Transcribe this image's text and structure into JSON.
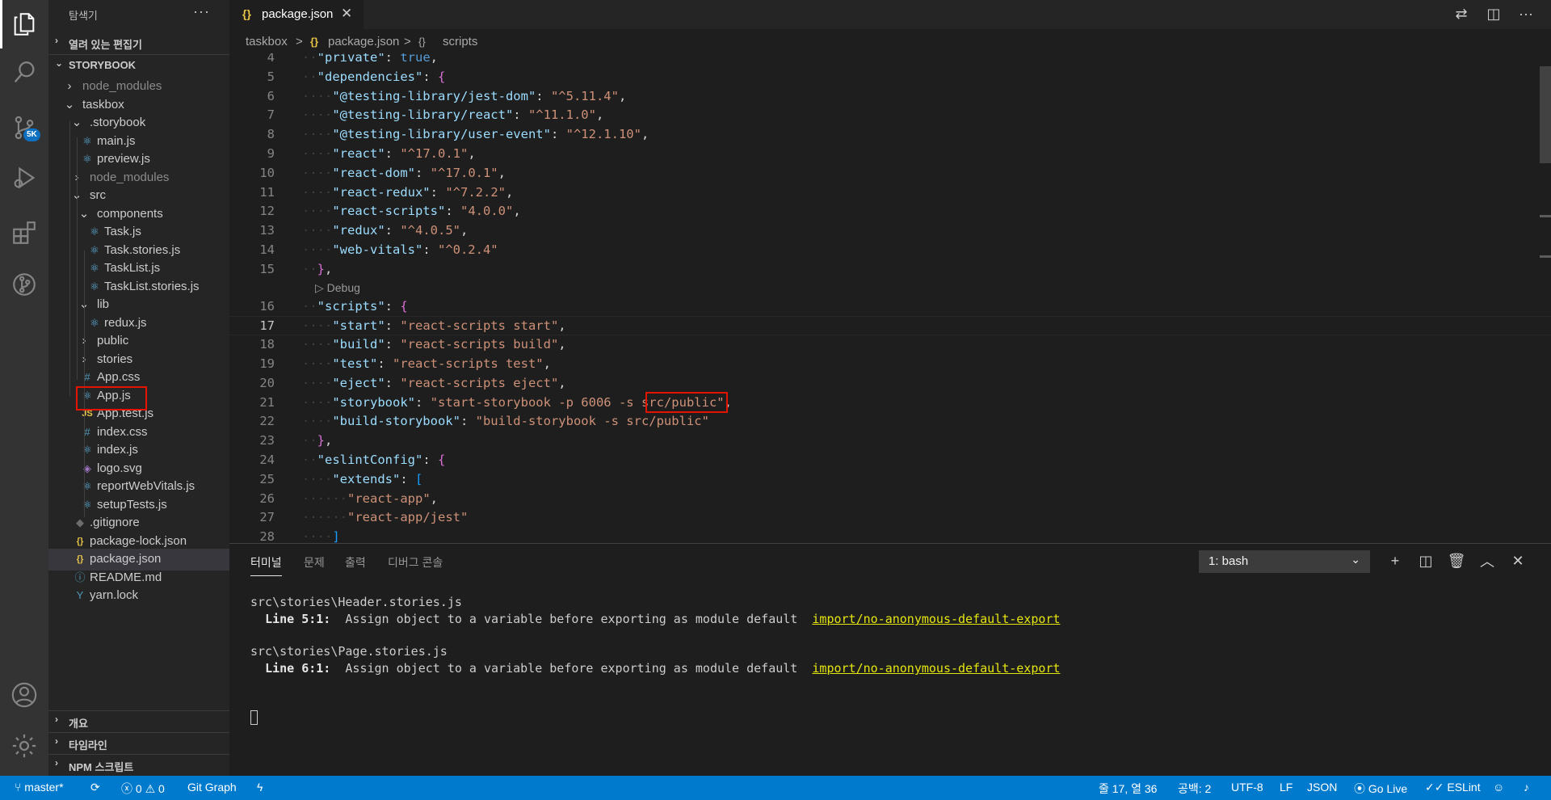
{
  "sidebar": {
    "title": "탐색기",
    "more": "···",
    "open_editors": "열려 있는 편집기",
    "workspace": "STORYBOOK",
    "tree": [
      {
        "name": "node_modules",
        "depth": 0,
        "kind": "folder",
        "open": false,
        "dim": true
      },
      {
        "name": "taskbox",
        "depth": 0,
        "kind": "folder",
        "open": true
      },
      {
        "name": ".storybook",
        "depth": 1,
        "kind": "folder",
        "open": true
      },
      {
        "name": "main.js",
        "depth": 2,
        "kind": "react"
      },
      {
        "name": "preview.js",
        "depth": 2,
        "kind": "react"
      },
      {
        "name": "node_modules",
        "depth": 1,
        "kind": "folder",
        "open": false,
        "dim": true
      },
      {
        "name": "src",
        "depth": 1,
        "kind": "folder",
        "open": true
      },
      {
        "name": "components",
        "depth": 2,
        "kind": "folder",
        "open": true
      },
      {
        "name": "Task.js",
        "depth": 3,
        "kind": "react"
      },
      {
        "name": "Task.stories.js",
        "depth": 3,
        "kind": "react"
      },
      {
        "name": "TaskList.js",
        "depth": 3,
        "kind": "react"
      },
      {
        "name": "TaskList.stories.js",
        "depth": 3,
        "kind": "react"
      },
      {
        "name": "lib",
        "depth": 2,
        "kind": "folder",
        "open": true
      },
      {
        "name": "redux.js",
        "depth": 3,
        "kind": "react"
      },
      {
        "name": "public",
        "depth": 2,
        "kind": "folder",
        "open": false
      },
      {
        "name": "stories",
        "depth": 2,
        "kind": "folder",
        "open": false
      },
      {
        "name": "App.css",
        "depth": 2,
        "kind": "css"
      },
      {
        "name": "App.js",
        "depth": 2,
        "kind": "react"
      },
      {
        "name": "App.test.js",
        "depth": 2,
        "kind": "js"
      },
      {
        "name": "index.css",
        "depth": 2,
        "kind": "css"
      },
      {
        "name": "index.js",
        "depth": 2,
        "kind": "react"
      },
      {
        "name": "logo.svg",
        "depth": 2,
        "kind": "svg"
      },
      {
        "name": "reportWebVitals.js",
        "depth": 2,
        "kind": "react"
      },
      {
        "name": "setupTests.js",
        "depth": 2,
        "kind": "react"
      },
      {
        "name": ".gitignore",
        "depth": 1,
        "kind": "git"
      },
      {
        "name": "package-lock.json",
        "depth": 1,
        "kind": "json"
      },
      {
        "name": "package.json",
        "depth": 1,
        "kind": "json",
        "selected": true
      },
      {
        "name": "README.md",
        "depth": 1,
        "kind": "info"
      },
      {
        "name": "yarn.lock",
        "depth": 1,
        "kind": "yarn"
      }
    ],
    "outline": "개요",
    "timeline": "타임라인",
    "npm_scripts": "NPM 스크립트"
  },
  "activity": {
    "scm_badge": "5K"
  },
  "tab": {
    "icon": "{}",
    "name": "package.json",
    "close": "✕"
  },
  "breadcrumb": {
    "folder": "taskbox",
    "sep": ">",
    "file_icon": "{}",
    "file": "package.json",
    "sym_icon": "{}",
    "symbol": "scripts"
  },
  "code": {
    "codelens": "▷ Debug",
    "lines": [
      {
        "n": "4",
        "indent": 1,
        "toks": [
          [
            "k",
            "\"private\""
          ],
          [
            "p",
            ": "
          ],
          [
            "bool",
            "true"
          ],
          [
            "p",
            ","
          ]
        ]
      },
      {
        "n": "5",
        "indent": 1,
        "toks": [
          [
            "k",
            "\"dependencies\""
          ],
          [
            "p",
            ": "
          ],
          [
            "b2",
            "{"
          ]
        ]
      },
      {
        "n": "6",
        "indent": 2,
        "toks": [
          [
            "k",
            "\"@testing-library/jest-dom\""
          ],
          [
            "p",
            ": "
          ],
          [
            "s",
            "\"^5.11.4\""
          ],
          [
            "p",
            ","
          ]
        ]
      },
      {
        "n": "7",
        "indent": 2,
        "toks": [
          [
            "k",
            "\"@testing-library/react\""
          ],
          [
            "p",
            ": "
          ],
          [
            "s",
            "\"^11.1.0\""
          ],
          [
            "p",
            ","
          ]
        ]
      },
      {
        "n": "8",
        "indent": 2,
        "toks": [
          [
            "k",
            "\"@testing-library/user-event\""
          ],
          [
            "p",
            ": "
          ],
          [
            "s",
            "\"^12.1.10\""
          ],
          [
            "p",
            ","
          ]
        ]
      },
      {
        "n": "9",
        "indent": 2,
        "toks": [
          [
            "k",
            "\"react\""
          ],
          [
            "p",
            ": "
          ],
          [
            "s",
            "\"^17.0.1\""
          ],
          [
            "p",
            ","
          ]
        ]
      },
      {
        "n": "10",
        "indent": 2,
        "toks": [
          [
            "k",
            "\"react-dom\""
          ],
          [
            "p",
            ": "
          ],
          [
            "s",
            "\"^17.0.1\""
          ],
          [
            "p",
            ","
          ]
        ]
      },
      {
        "n": "11",
        "indent": 2,
        "toks": [
          [
            "k",
            "\"react-redux\""
          ],
          [
            "p",
            ": "
          ],
          [
            "s",
            "\"^7.2.2\""
          ],
          [
            "p",
            ","
          ]
        ]
      },
      {
        "n": "12",
        "indent": 2,
        "toks": [
          [
            "k",
            "\"react-scripts\""
          ],
          [
            "p",
            ": "
          ],
          [
            "s",
            "\"4.0.0\""
          ],
          [
            "p",
            ","
          ]
        ]
      },
      {
        "n": "13",
        "indent": 2,
        "toks": [
          [
            "k",
            "\"redux\""
          ],
          [
            "p",
            ": "
          ],
          [
            "s",
            "\"^4.0.5\""
          ],
          [
            "p",
            ","
          ]
        ]
      },
      {
        "n": "14",
        "indent": 2,
        "toks": [
          [
            "k",
            "\"web-vitals\""
          ],
          [
            "p",
            ": "
          ],
          [
            "s",
            "\"^0.2.4\""
          ]
        ]
      },
      {
        "n": "15",
        "indent": 1,
        "toks": [
          [
            "b2",
            "}"
          ],
          [
            "p",
            ","
          ]
        ]
      },
      {
        "n": "",
        "codelens": true
      },
      {
        "n": "16",
        "indent": 1,
        "toks": [
          [
            "k",
            "\"scripts\""
          ],
          [
            "p",
            ": "
          ],
          [
            "b2",
            "{"
          ]
        ]
      },
      {
        "n": "17",
        "indent": 2,
        "cur": true,
        "toks": [
          [
            "k",
            "\"start\""
          ],
          [
            "p",
            ": "
          ],
          [
            "s",
            "\"react-scripts start\""
          ],
          [
            "p",
            ","
          ]
        ]
      },
      {
        "n": "18",
        "indent": 2,
        "toks": [
          [
            "k",
            "\"build\""
          ],
          [
            "p",
            ": "
          ],
          [
            "s",
            "\"react-scripts build\""
          ],
          [
            "p",
            ","
          ]
        ]
      },
      {
        "n": "19",
        "indent": 2,
        "toks": [
          [
            "k",
            "\"test\""
          ],
          [
            "p",
            ": "
          ],
          [
            "s",
            "\"react-scripts test\""
          ],
          [
            "p",
            ","
          ]
        ]
      },
      {
        "n": "20",
        "indent": 2,
        "toks": [
          [
            "k",
            "\"eject\""
          ],
          [
            "p",
            ": "
          ],
          [
            "s",
            "\"react-scripts eject\""
          ],
          [
            "p",
            ","
          ]
        ]
      },
      {
        "n": "21",
        "indent": 2,
        "toks": [
          [
            "k",
            "\"storybook\""
          ],
          [
            "p",
            ": "
          ],
          [
            "s",
            "\"start-storybook -p 6006 -s "
          ],
          [
            "sh",
            "src/public"
          ],
          [
            "s",
            "\""
          ],
          [
            "p",
            ","
          ]
        ]
      },
      {
        "n": "22",
        "indent": 2,
        "toks": [
          [
            "k",
            "\"build-storybook\""
          ],
          [
            "p",
            ": "
          ],
          [
            "s",
            "\"build-storybook -s src/public\""
          ]
        ]
      },
      {
        "n": "23",
        "indent": 1,
        "toks": [
          [
            "b2",
            "}"
          ],
          [
            "p",
            ","
          ]
        ]
      },
      {
        "n": "24",
        "indent": 1,
        "toks": [
          [
            "k",
            "\"eslintConfig\""
          ],
          [
            "p",
            ": "
          ],
          [
            "b2",
            "{"
          ]
        ]
      },
      {
        "n": "25",
        "indent": 2,
        "toks": [
          [
            "k",
            "\"extends\""
          ],
          [
            "p",
            ": "
          ],
          [
            "b3",
            "["
          ]
        ]
      },
      {
        "n": "26",
        "indent": 3,
        "toks": [
          [
            "s",
            "\"react-app\""
          ],
          [
            "p",
            ","
          ]
        ]
      },
      {
        "n": "27",
        "indent": 3,
        "toks": [
          [
            "s",
            "\"react-app/jest\""
          ]
        ]
      },
      {
        "n": "28",
        "indent": 2,
        "toks": [
          [
            "b3",
            "]"
          ]
        ]
      }
    ]
  },
  "panel": {
    "tabs": [
      "터미널",
      "문제",
      "출력",
      "디버그 콘솔"
    ],
    "terminal_select": "1: bash",
    "output": [
      {
        "file": "src\\stories\\Header.stories.js",
        "loc": "Line 5:1:",
        "msg": "Assign object to a variable before exporting as module default",
        "rule": "import/no-anonymous-default-export"
      },
      {
        "file": "src\\stories\\Page.stories.js",
        "loc": "Line 6:1:",
        "msg": "Assign object to a variable before exporting as module default",
        "rule": "import/no-anonymous-default-export"
      }
    ]
  },
  "status": {
    "branch": "master*",
    "errors": "0",
    "warnings": "0",
    "git_graph": "Git Graph",
    "position": "줄 17, 열 36",
    "spaces": "공백: 2",
    "encoding": "UTF-8",
    "eol": "LF",
    "language": "JSON",
    "go_live": "Go Live",
    "eslint": "ESLint"
  }
}
